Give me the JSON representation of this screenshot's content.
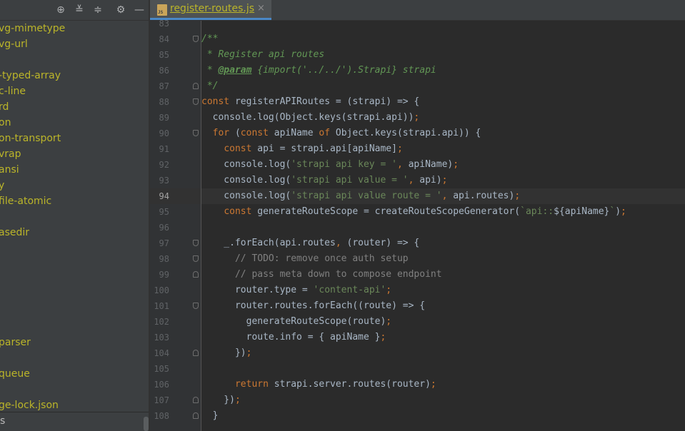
{
  "sidebar": {
    "items": [
      "vg-mimetype",
      "vg-url",
      "",
      "-typed-array",
      "c-line",
      "rd",
      "on",
      "on-transport",
      "vrap",
      "ansi",
      "y",
      "file-atomic",
      "",
      "asedir",
      "",
      "",
      "",
      "",
      "",
      "",
      "parser",
      "",
      "queue",
      "",
      "ge-lock.json"
    ],
    "bottom_label": "s",
    "toolbar_icons": [
      "locate-icon",
      "expand-all-icon",
      "collapse-all-icon",
      "gear-icon",
      "minimize-icon"
    ]
  },
  "tab": {
    "title": "register-routes.js",
    "file_icon_label": "JS",
    "close": "×"
  },
  "editor": {
    "current_line": 94,
    "lines": [
      {
        "n": "83",
        "html": ""
      },
      {
        "n": "84",
        "html": "<span class=\"doc\">/**</span>"
      },
      {
        "n": "85",
        "html": "<span class=\"doc\"> * Register api routes</span>"
      },
      {
        "n": "86",
        "html": "<span class=\"doc\"> * </span><span class=\"doctag\">@param</span><span class=\"doc\"> {import('../../').Strapi} strapi</span>"
      },
      {
        "n": "87",
        "html": "<span class=\"doc\"> */</span>"
      },
      {
        "n": "88",
        "html": "<span class=\"kw\">const</span> registerAPIRoutes = (strapi) => {"
      },
      {
        "n": "89",
        "html": "  console.log(Object.keys(strapi.api))<span class=\"kw\">;</span>"
      },
      {
        "n": "90",
        "html": "  <span class=\"kw\">for</span> (<span class=\"kw\">const</span> apiName <span class=\"kw\">of</span> Object.keys(strapi.api)) {"
      },
      {
        "n": "91",
        "html": "    <span class=\"kw\">const</span> api = strapi.api[apiName]<span class=\"kw\">;</span>"
      },
      {
        "n": "92",
        "html": "    console.log(<span class=\"str\">'strapi api key = '</span><span class=\"kw\">,</span> apiName)<span class=\"kw\">;</span>"
      },
      {
        "n": "93",
        "html": "    console.log(<span class=\"str\">'strapi api value = '</span><span class=\"kw\">,</span> api)<span class=\"kw\">;</span>"
      },
      {
        "n": "94",
        "html": "    console.log(<span class=\"str\">'strapi api value route = '</span><span class=\"kw\">,</span> api.routes)<span class=\"kw\">;</span>"
      },
      {
        "n": "95",
        "html": "    <span class=\"kw\">const</span> generateRouteScope = createRouteScopeGenerator(<span class=\"str\">`api::</span>${apiName}<span class=\"str\">`</span>)<span class=\"kw\">;</span>"
      },
      {
        "n": "96",
        "html": ""
      },
      {
        "n": "97",
        "html": "    _.forEach(api.routes<span class=\"kw\">,</span> (router) => {"
      },
      {
        "n": "98",
        "html": "      <span class=\"cm\">// TODO: remove once auth setup</span>"
      },
      {
        "n": "99",
        "html": "      <span class=\"cm\">// pass meta down to compose endpoint</span>"
      },
      {
        "n": "100",
        "html": "      router.type = <span class=\"str\">'content-api'</span><span class=\"kw\">;</span>"
      },
      {
        "n": "101",
        "html": "      router.routes.forEach((route) => {"
      },
      {
        "n": "102",
        "html": "        generateRouteScope(route)<span class=\"kw\">;</span>"
      },
      {
        "n": "103",
        "html": "        route.info = { apiName }<span class=\"kw\">;</span>"
      },
      {
        "n": "104",
        "html": "      })<span class=\"kw\">;</span>"
      },
      {
        "n": "105",
        "html": ""
      },
      {
        "n": "106",
        "html": "      <span class=\"kw\">return</span> strapi.server.routes(router)<span class=\"kw\">;</span>"
      },
      {
        "n": "107",
        "html": "    })<span class=\"kw\">;</span>"
      },
      {
        "n": "108",
        "html": "  }"
      }
    ],
    "folds": {
      "84": "start",
      "87": "end",
      "88": "start",
      "90": "start",
      "97": "start",
      "98": "start",
      "99": "end",
      "101": "start",
      "104": "end",
      "107": "end",
      "108": "end"
    }
  }
}
